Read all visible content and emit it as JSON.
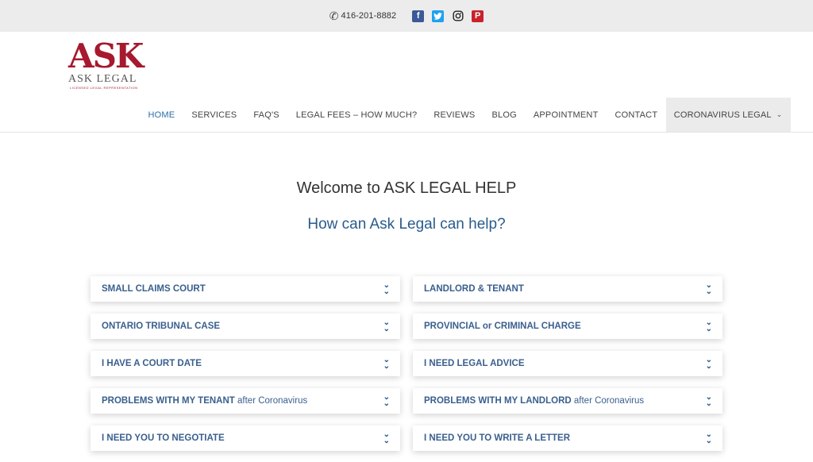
{
  "topbar": {
    "phone": "416-201-8882",
    "social": [
      "facebook-icon",
      "twitter-icon",
      "instagram-icon",
      "pinterest-icon"
    ]
  },
  "logo": {
    "main": "ASK",
    "sub": "ASK LEGAL",
    "tagline": "LICENSED LEGAL REPRESENTATION"
  },
  "nav": {
    "items": [
      "HOME",
      "SERVICES",
      "FAQ'S",
      "LEGAL FEES – HOW MUCH?",
      "REVIEWS",
      "BLOG",
      "APPOINTMENT",
      "CONTACT",
      "CORONAVIRUS LEGAL"
    ],
    "active": "HOME"
  },
  "hero": {
    "welcome": "Welcome to ASK LEGAL HELP",
    "subhead": "How can Ask Legal can help?"
  },
  "cards": [
    {
      "label": "SMALL CLAIMS COURT",
      "suffix": ""
    },
    {
      "label": "LANDLORD & TENANT",
      "suffix": ""
    },
    {
      "label": "ONTARIO TRIBUNAL CASE",
      "suffix": ""
    },
    {
      "label": "PROVINCIAL or CRIMINAL CHARGE",
      "suffix": ""
    },
    {
      "label": "I HAVE A COURT DATE",
      "suffix": ""
    },
    {
      "label": "I NEED LEGAL ADVICE",
      "suffix": ""
    },
    {
      "label": "PROBLEMS WITH MY TENANT",
      "suffix": " after Coronavirus"
    },
    {
      "label": "PROBLEMS WITH MY LANDLORD",
      "suffix": " after Coronavirus"
    },
    {
      "label": "I NEED YOU TO NEGOTIATE",
      "suffix": ""
    },
    {
      "label": "I NEED YOU TO WRITE A LETTER",
      "suffix": ""
    }
  ],
  "colors": {
    "brand": "#a6192e",
    "accent": "#2a5b8c"
  }
}
